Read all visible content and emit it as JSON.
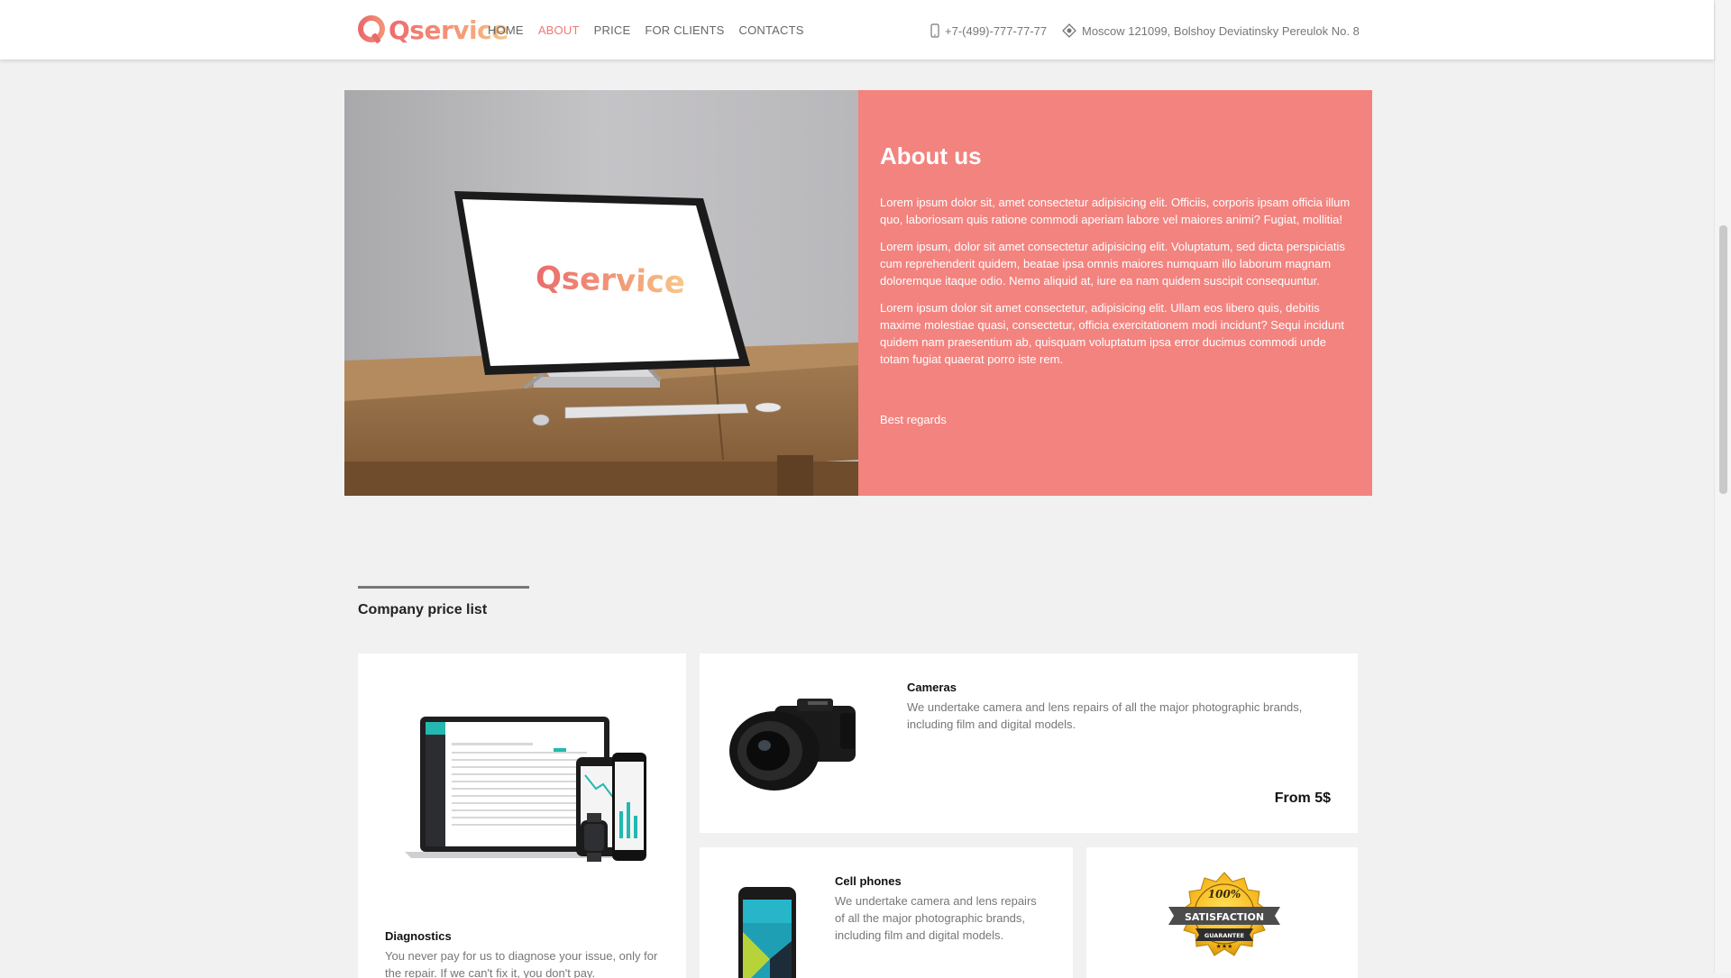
{
  "header": {
    "logo": "Qservice",
    "nav": [
      "HOME",
      "ABOUT",
      "PRICE",
      "FOR CLIENTS",
      "CONTACTS"
    ],
    "active_nav": "ABOUT",
    "phone": "+7-(499)-777-77-77",
    "address": "Moscow 121099, Bolshoy Deviatinsky Pereulok No. 8"
  },
  "about": {
    "screen_logo": "Qservice",
    "title": "About us",
    "paragraphs": [
      "Lorem ipsum dolor sit, amet consectetur adipisicing elit. Officiis, corporis ipsam officia illum quo, laboriosam quis ratione commodi aperiam labore vel maiores animi? Fugiat, mollitia!",
      "Lorem ipsum, dolor sit amet consectetur adipisicing elit. Voluptatum, sed dicta perspiciatis cum reprehenderit quidem, beatae ipsa omnis maiores numquam illo laborum magnam doloremque itaque odio. Nemo aliquid at, iure ea nam quidem suscipit consequuntur.",
      "Lorem ipsum dolor sit amet consectetur, adipisicing elit. Ullam eos libero quis, debitis maxime molestiae quasi, consectetur, officia exercitationem modi incidunt? Sequi incidunt quidem nam praesentium ab, quisquam voluptatum ipsa error ducimus commodi unde totam fugiat quaerat porro iste rem."
    ],
    "regards": "Best regards"
  },
  "price_list": {
    "title": "Company price list",
    "cards": {
      "diagnostics": {
        "title": "Diagnostics",
        "desc": "You never pay for us to diagnose your issue, only for the repair. If we can't fix it, you don't pay."
      },
      "cameras": {
        "title": "Cameras",
        "desc": "We undertake camera and lens repairs of all the major photographic brands, including film and digital models.",
        "price": "From 5$"
      },
      "cell_phones": {
        "title": "Cell phones",
        "desc": "We undertake camera and lens repairs of all the major photographic brands, including film and digital models."
      },
      "guarantee": {
        "badge_top": "100%",
        "badge_mid": "SATISFACTION",
        "badge_bottom": "GUARANTEE"
      }
    }
  },
  "colors": {
    "accent": "#f2837f",
    "nav_active": "#ee7a76",
    "background": "#f1f1f1"
  }
}
